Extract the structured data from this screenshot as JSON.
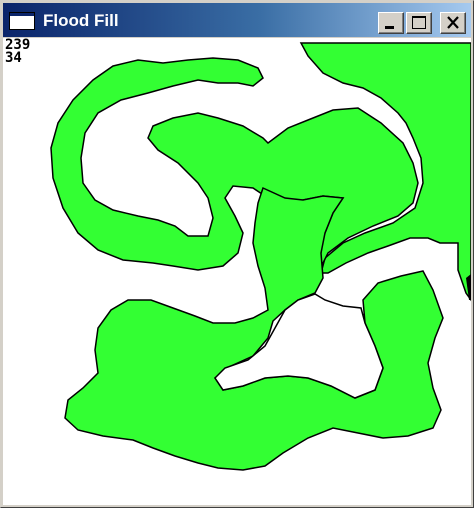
{
  "window": {
    "title": "Flood Fill",
    "icon": "window-icon",
    "controls": {
      "minimize_icon": "minimize-icon",
      "maximize_icon": "maximize-icon",
      "close_icon": "close-icon"
    }
  },
  "canvas": {
    "coord_x": "239",
    "coord_y": "34",
    "fill_color": "#33ff33",
    "outline_color": "#000000",
    "background_color": "#ffffff"
  },
  "colors": {
    "titlebar_start": "#0a246a",
    "titlebar_end": "#a6caf0",
    "chrome": "#d4d0c8"
  }
}
